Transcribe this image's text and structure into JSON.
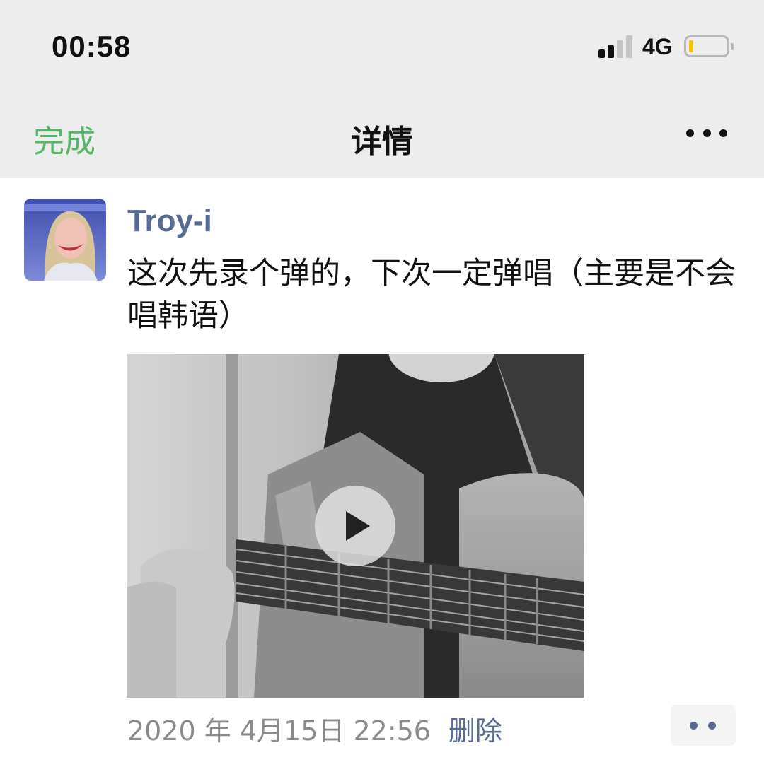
{
  "status_bar": {
    "time": "00:58",
    "network": "4G",
    "signal_icon": "cellular-signal-icon",
    "battery_icon": "battery-low-icon"
  },
  "nav": {
    "done_label": "完成",
    "title": "详情",
    "more_icon": "more-icon"
  },
  "post": {
    "username": "Troy-i",
    "text": "这次先录个弹的，下次一定弹唱（主要是不会唱韩语）",
    "video_icon": "play-icon",
    "timestamp": "2020 年 4月15日 22:56",
    "delete_label": "删除",
    "comment_icon": "comment-dots-icon"
  },
  "colors": {
    "accent_green": "#55b766",
    "link_blue": "#576b95",
    "bar_background": "#ededed",
    "battery_level": "#f2c500"
  }
}
